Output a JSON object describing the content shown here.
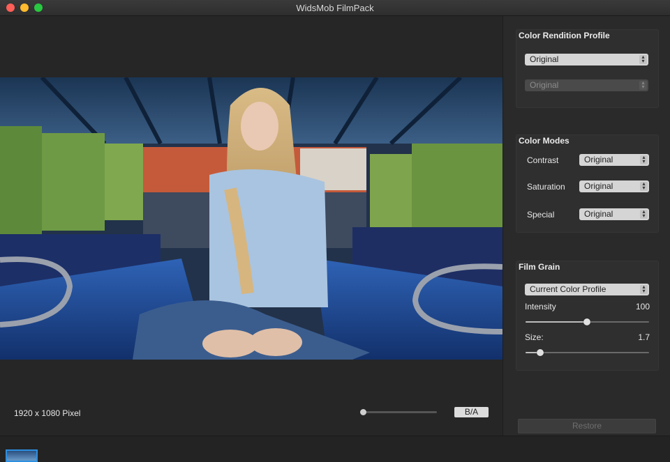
{
  "window": {
    "title": "WidsMob FilmPack"
  },
  "status": {
    "dimensions": "1920 x 1080 Pixel",
    "ba_label": "B/A"
  },
  "color_rendition": {
    "title": "Color Rendition Profile",
    "profile": "Original",
    "sub_profile": "Original"
  },
  "color_modes": {
    "title": "Color Modes",
    "contrast_label": "Contrast",
    "contrast_value": "Original",
    "saturation_label": "Saturation",
    "saturation_value": "Original",
    "special_label": "Special",
    "special_value": "Original"
  },
  "film_grain": {
    "title": "Film Grain",
    "profile": "Current Color Profile",
    "intensity_label": "Intensity",
    "intensity_value": "100",
    "size_label": "Size:",
    "size_value": "1.7"
  },
  "restore_label": "Restore",
  "icons": [
    "close-icon",
    "minimize-icon",
    "maximize-icon",
    "stepper-arrows-icon",
    "cursor-icon"
  ],
  "colors": {
    "accent": "#2e8fe0",
    "panel": "#2f2f2f",
    "background": "#262626"
  }
}
